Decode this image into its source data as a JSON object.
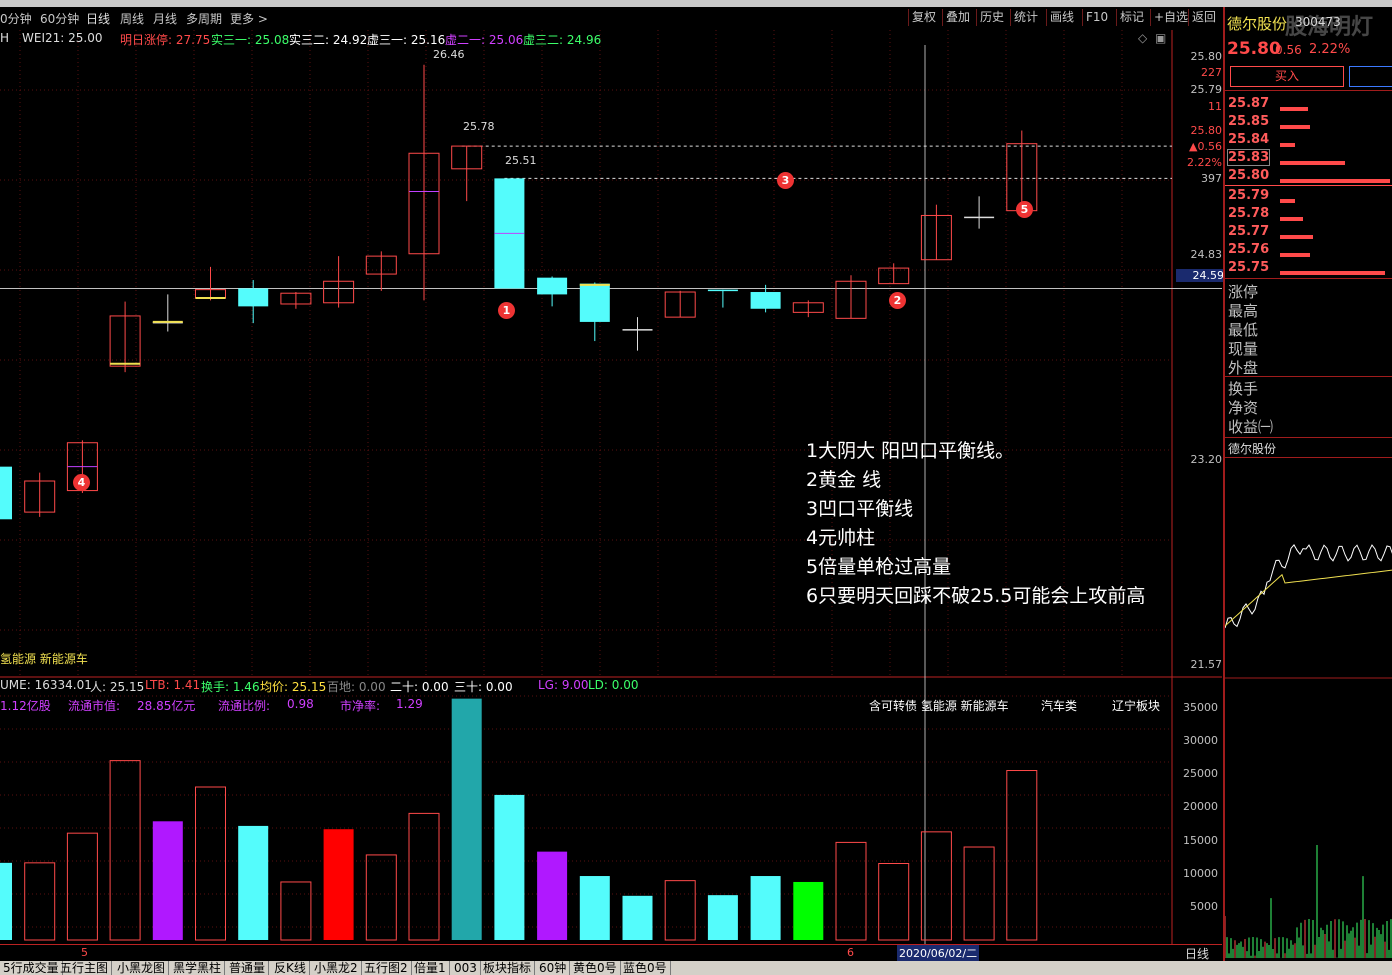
{
  "toolbar": {
    "periods": [
      "0分钟",
      "60分钟",
      "日线",
      "周线",
      "月线",
      "多周期",
      "更多 >"
    ],
    "active_period": "日线",
    "right_buttons": [
      "复权",
      "叠加",
      "历史",
      "统计",
      "画线",
      "F10",
      "标记",
      "+自选",
      "返回"
    ]
  },
  "legend": {
    "h": "H",
    "wei21": "WEI21: 25.00",
    "limit_up": "明日涨停: 27.75",
    "s31": "实三一: 25.08",
    "s32": "实三二: 24.92",
    "x31": "虚三一: 25.16",
    "x21": "虚二一: 25.06",
    "x32": "虚三二: 24.96"
  },
  "price_labels": {
    "high": "26.46",
    "l1": "25.78",
    "l2": "25.51"
  },
  "y_axis": {
    "ticks": [
      "25.80",
      "227",
      "25.79",
      "11",
      "25.80",
      "▲0.56",
      "2.22%",
      "397",
      "24.83",
      "24.59",
      "23.20",
      "21.57"
    ],
    "current": "24.59"
  },
  "concepts_main": "氢能源 新能源车",
  "annotations": [
    "1大阴大 阳凹口平衡线。",
    "2黄金 线",
    "3凹口平衡线",
    "4元帅柱",
    "5倍量单枪过高量",
    "6只要明天回踩不破25.5可能会上攻前高"
  ],
  "markers": [
    "1",
    "2",
    "3",
    "4",
    "5"
  ],
  "vol_header": {
    "volume": "UME: 16334.01",
    "ren": "人: 25.15",
    "ltb": "LTB: 1.41",
    "turnover": "换手: 1.46",
    "avg": "均价: 25.15",
    "baidi": "百地: 0.00",
    "ershi": "二十: 0.00",
    "sanshi": "三十: 0.00",
    "lg": "LG: 9.00",
    "ld": "LD: 0.00"
  },
  "vol_info": {
    "cap": "1.12亿股",
    "float_value_label": "流通市值:",
    "float_value": "28.85亿元",
    "float_ratio_label": "流通比例:",
    "float_ratio": "0.98",
    "pb_label": "市净率:",
    "pb": "1.29",
    "tags": "含可转债 氢能源 新能源车",
    "tag2": "汽车类",
    "tag3": "辽宁板块"
  },
  "vol_axis": [
    "35000",
    "30000",
    "25000",
    "20000",
    "15000",
    "10000",
    "5000"
  ],
  "bottom_axis": {
    "m5": "5",
    "m6": "6",
    "date": "2020/06/02/二",
    "period": "日线"
  },
  "bottom_tabs": [
    "5行成交量",
    "五行主图",
    "小黑龙图",
    "黑学黑柱",
    "普通量",
    "反K线",
    "小黑龙2",
    "五行图2",
    "倍量1",
    "003",
    "板块指标",
    "60钟",
    "黄色0号",
    "蓝色0号"
  ],
  "quote": {
    "name": "德尔股份",
    "code": "300473",
    "price": "25.80",
    "change": "0.56",
    "pct": "2.22%",
    "buy": "买入",
    "order_rows": [
      {
        "price": "25.87",
        "size": 0.55
      },
      {
        "price": "25.85",
        "size": 0.6
      },
      {
        "price": "25.84",
        "size": 0.3
      },
      {
        "price": "25.83",
        "size": 1.3
      },
      {
        "price": "25.80",
        "size": 2.2
      },
      {
        "price": "25.79",
        "size": 0.3
      },
      {
        "price": "25.78",
        "size": 0.45
      },
      {
        "price": "25.77",
        "size": 0.65
      },
      {
        "price": "25.76",
        "size": 0.6
      },
      {
        "price": "25.75",
        "size": 2.1
      }
    ],
    "labels1": [
      "涨停",
      "最高",
      "最低",
      "现量",
      "外盘"
    ],
    "labels2": [
      "换手",
      "净资",
      "收益㈠"
    ],
    "mini_title": "德尔股份",
    "watermark": "股海明灯"
  },
  "colors": {
    "up": "#ff4a4a",
    "down": "#54fcfc",
    "purple": "#b018ff",
    "green": "#00ff00",
    "teal": "#22a7aa"
  },
  "chart_data": {
    "type": "candlestick",
    "candles": [
      {
        "o": 23.1,
        "c": 22.66,
        "h": 23.12,
        "l": 22.66
      },
      {
        "o": 22.72,
        "c": 22.98,
        "h": 23.05,
        "l": 22.68
      },
      {
        "o": 22.9,
        "c": 23.3,
        "h": 23.32,
        "l": 22.88
      },
      {
        "o": 23.94,
        "c": 24.36,
        "h": 24.48,
        "l": 23.89
      },
      {
        "o": 24.31,
        "c": 24.31,
        "h": 24.54,
        "l": 24.23
      },
      {
        "o": 24.51,
        "c": 24.58,
        "h": 24.77,
        "l": 24.49
      },
      {
        "o": 24.59,
        "c": 24.44,
        "h": 24.66,
        "l": 24.3
      },
      {
        "o": 24.46,
        "c": 24.55,
        "h": 24.56,
        "l": 24.42
      },
      {
        "o": 24.47,
        "c": 24.65,
        "h": 24.86,
        "l": 24.43
      },
      {
        "o": 24.71,
        "c": 24.86,
        "h": 24.9,
        "l": 24.57
      },
      {
        "o": 24.88,
        "c": 25.72,
        "h": 26.46,
        "l": 24.49
      },
      {
        "o": 25.59,
        "c": 25.78,
        "h": 25.78,
        "l": 25.32
      },
      {
        "o": 25.51,
        "c": 24.59,
        "h": 25.51,
        "l": 24.59
      },
      {
        "o": 24.68,
        "c": 24.54,
        "h": 24.69,
        "l": 24.44
      },
      {
        "o": 24.63,
        "c": 24.31,
        "h": 24.64,
        "l": 24.15
      },
      {
        "o": 24.25,
        "c": 24.25,
        "h": 24.35,
        "l": 24.07
      },
      {
        "o": 24.35,
        "c": 24.56,
        "h": 24.57,
        "l": 24.35
      },
      {
        "o": 24.58,
        "c": 24.57,
        "h": 24.58,
        "l": 24.43
      },
      {
        "o": 24.56,
        "c": 24.42,
        "h": 24.62,
        "l": 24.39
      },
      {
        "o": 24.39,
        "c": 24.47,
        "h": 24.49,
        "l": 24.35
      },
      {
        "o": 24.34,
        "c": 24.65,
        "h": 24.7,
        "l": 24.34
      },
      {
        "o": 24.63,
        "c": 24.76,
        "h": 24.8,
        "l": 24.63
      },
      {
        "o": 24.83,
        "c": 25.2,
        "h": 25.29,
        "l": 24.83
      },
      {
        "o": 25.19,
        "c": 25.19,
        "h": 25.36,
        "l": 25.09
      },
      {
        "o": 25.24,
        "c": 25.8,
        "h": 25.91,
        "l": 25.21
      }
    ],
    "volumes": [
      11700,
      11700,
      16200,
      27200,
      18000,
      23200,
      17300,
      8800,
      16800,
      12900,
      19200,
      36600,
      22000,
      13400,
      9700,
      6700,
      9000,
      6800,
      9700,
      8800,
      14800,
      11600,
      16400,
      14100,
      25700
    ],
    "volume_colors": [
      "down",
      "up",
      "up",
      "up",
      "purple",
      "up",
      "down",
      "up",
      "red",
      "up",
      "up",
      "teal",
      "down",
      "purple",
      "down",
      "down",
      "up",
      "down",
      "down",
      "green",
      "up",
      "up",
      "up",
      "up",
      "up"
    ],
    "price_range": [
      21.4,
      26.6
    ],
    "volume_range": [
      0,
      37000
    ]
  }
}
